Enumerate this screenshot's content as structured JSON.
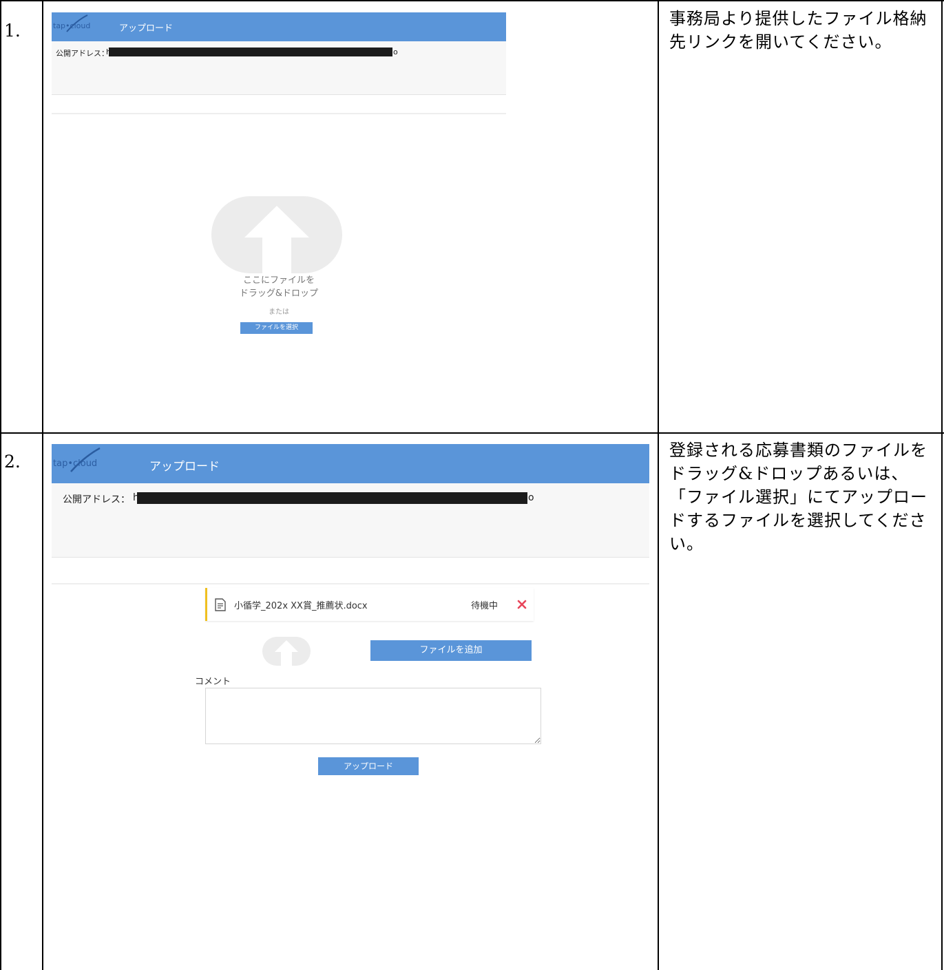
{
  "steps": [
    {
      "number": "1.",
      "description": "事務局より提供したファイル格納先リンクを開いてください。",
      "screen": {
        "logo": "tap•cloud",
        "header_title": "アップロード",
        "address_label": "公開アドレス：",
        "address_visible_start": "h",
        "address_visible_end": "o",
        "drop_line1": "ここにファイルを",
        "drop_line2": "ドラッグ&ドロップ",
        "or_text": "または",
        "select_button": "ファイルを選択"
      }
    },
    {
      "number": "2.",
      "description": "登録される応募書類のファイルをドラッグ&ドロップあるいは、「ファイル選択」にてアップロードするファイルを選択してください。",
      "screen": {
        "logo": "tap•cloud",
        "header_title": "アップロード",
        "address_label": "公開アドレス：",
        "address_visible_start": "h",
        "address_visible_end": "o",
        "file_name": "小循学_202x XX賞_推薦状.docx",
        "file_status": "待機中",
        "add_file_button": "ファイルを追加",
        "comment_label": "コメント",
        "comment_value": "",
        "upload_button": "アップロード"
      }
    }
  ],
  "colors": {
    "header_blue": "#5a95d9",
    "file_accent": "#f0c020",
    "remove_red": "#e8455a"
  },
  "icons": [
    "upload-arrow-icon",
    "document-icon",
    "close-icon",
    "resize-grip-icon"
  ]
}
